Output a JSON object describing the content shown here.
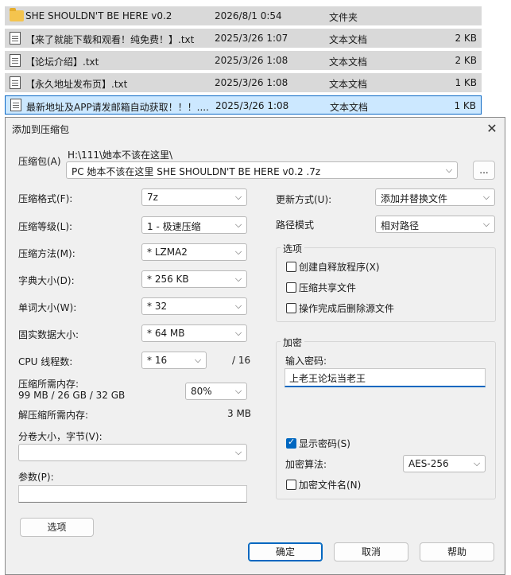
{
  "files": [
    {
      "name": "SHE SHOULDN'T BE HERE v0.2",
      "date": "2026/8/1 0:54",
      "type": "文件夹",
      "size": "",
      "icon": "folder-icon",
      "selected": false
    },
    {
      "name": "【来了就能下载和观看！纯免费！】.txt",
      "date": "2025/3/26 1:07",
      "type": "文本文档",
      "size": "2 KB",
      "icon": "text-file-icon",
      "selected": false
    },
    {
      "name": "【论坛介绍】.txt",
      "date": "2025/3/26 1:08",
      "type": "文本文档",
      "size": "2 KB",
      "icon": "text-file-icon",
      "selected": false
    },
    {
      "name": "【永久地址发布页】.txt",
      "date": "2025/3/26 1:08",
      "type": "文本文档",
      "size": "1 KB",
      "icon": "text-file-icon",
      "selected": false
    },
    {
      "name": "最新地址及APP请发邮箱自动获取！！！....",
      "date": "2025/3/26 1:08",
      "type": "文本文档",
      "size": "1 KB",
      "icon": "text-file-icon",
      "selected": true
    }
  ],
  "dialog": {
    "title": "添加到压缩包",
    "close_glyph": "✕",
    "archive_label": "压缩包(A)",
    "archive_path": "H:\\111\\她本不该在这里\\",
    "archive_name": "PC 她本不该在这里 SHE SHOULDN'T BE HERE v0.2 .7z",
    "browse_label": "...",
    "format_label": "压缩格式(F):",
    "format_value": "7z",
    "level_label": "压缩等级(L):",
    "level_value": "1 - 极速压缩",
    "method_label": "压缩方法(M):",
    "method_value": "* LZMA2",
    "dict_label": "字典大小(D):",
    "dict_value": "* 256 KB",
    "word_label": "单词大小(W):",
    "word_value": "* 32",
    "solid_label": "固实数据大小:",
    "solid_value": "* 64 MB",
    "cpu_label": "CPU 线程数:",
    "cpu_value": "* 16",
    "cpu_total": "/ 16",
    "mem_label": "压缩所需内存:",
    "mem_value": "99 MB / 26 GB / 32 GB",
    "mem_percent": "80%",
    "decomp_label": "解压缩所需内存:",
    "decomp_value": "3 MB",
    "volume_label": "分卷大小，字节(V):",
    "volume_value": "",
    "params_label": "参数(P):",
    "params_value": "",
    "options_btn": "选项",
    "update_label": "更新方式(U):",
    "update_value": "添加并替换文件",
    "path_mode_label": "路径模式",
    "path_mode_value": "相对路径",
    "options_group": "选项",
    "opt_sfx": "创建自释放程序(X)",
    "opt_shared": "压缩共享文件",
    "opt_delete": "操作完成后删除源文件",
    "encrypt_group": "加密",
    "password_label": "输入密码:",
    "password_value": "上老王论坛当老王",
    "show_password": "显示密码(S)",
    "show_password_checked": true,
    "enc_method_label": "加密算法:",
    "enc_method_value": "AES-256",
    "encrypt_names": "加密文件名(N)",
    "ok_btn": "确定",
    "cancel_btn": "取消",
    "help_btn": "帮助",
    "dropdown_arrow": "⌵"
  },
  "colors": {
    "selection": "#cce8ff",
    "selection_border": "#0a67c4",
    "accent": "#0067c0",
    "row_bg": "#d9d9d9",
    "dialog_bg": "#f0f0f0"
  }
}
